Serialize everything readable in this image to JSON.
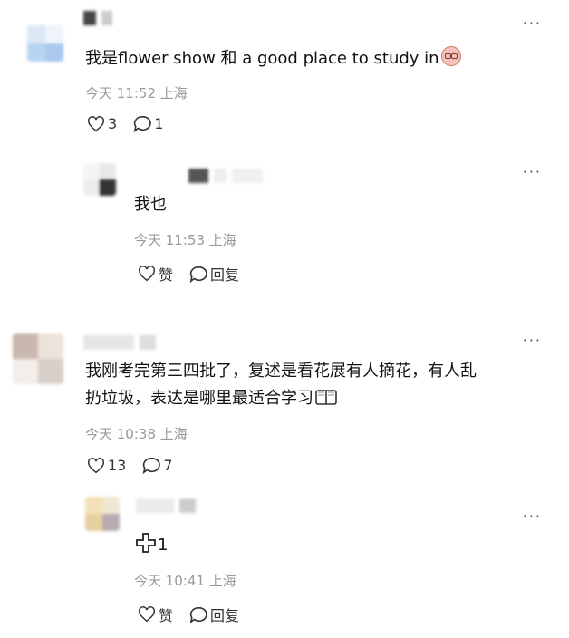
{
  "comments": [
    {
      "text": "我是flower show 和 a good place to study in",
      "meta": "今天 11:52 上海",
      "likes": "3",
      "replies": "1",
      "more": "···",
      "reply": {
        "text": "我也",
        "meta": "今天 11:53 上海",
        "like_label": "赞",
        "reply_label": "回复",
        "more": "···"
      }
    },
    {
      "text_line1": "我刚考完第三四批了，复述是看花展有人摘花，有人乱",
      "text_line2": "扔垃圾，表达是哪里最适合学习",
      "meta": "今天 10:38 上海",
      "likes": "13",
      "replies": "7",
      "more": "···",
      "reply": {
        "text": "1",
        "meta": "今天 10:41 上海",
        "like_label": "赞",
        "reply_label": "回复",
        "more": "···"
      }
    }
  ],
  "icons": {
    "like": "heart-outline-icon",
    "comment": "speech-bubble-icon",
    "more": "more-dots-icon",
    "emoji_1": "blushing-face-emoji",
    "emoji_2": "open-book-emoji",
    "emoji_3": "plus-cross-emoji"
  }
}
